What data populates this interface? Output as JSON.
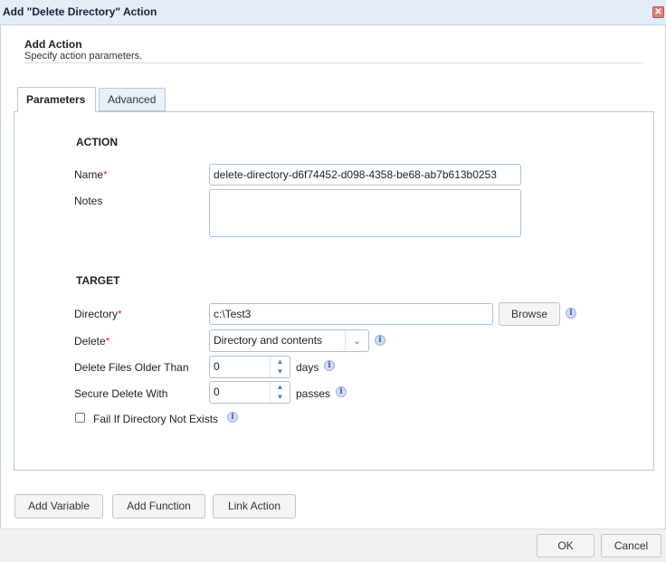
{
  "window": {
    "title": "Add \"Delete Directory\" Action",
    "close_glyph": "✕"
  },
  "header": {
    "title": "Add Action",
    "subtitle": "Specify action parameters."
  },
  "tabs": [
    {
      "label": "Parameters",
      "active": true
    },
    {
      "label": "Advanced",
      "active": false
    }
  ],
  "action_section": {
    "legend": "ACTION",
    "name_label": "Name",
    "name_value": "delete-directory-d6f74452-d098-4358-be68-ab7b613b0253",
    "notes_label": "Notes",
    "notes_value": ""
  },
  "target_section": {
    "legend": "TARGET",
    "directory_label": "Directory",
    "directory_value": "c:\\Test3",
    "browse_label": "Browse",
    "delete_label": "Delete",
    "delete_value": "Directory and contents",
    "older_than_label": "Delete Files Older Than",
    "older_than_value": "0",
    "older_than_unit": "days",
    "secure_label": "Secure Delete With",
    "secure_value": "0",
    "secure_unit": "passes",
    "fail_label": "Fail If Directory Not Exists",
    "fail_checked": false
  },
  "required_mark": "*",
  "info_glyph": "i",
  "buttons": {
    "add_variable": "Add Variable",
    "add_function": "Add Function",
    "link_action": "Link Action",
    "ok": "OK",
    "cancel": "Cancel"
  },
  "colors": {
    "accent_border": "#a9c2dc",
    "required": "#c0392b",
    "titlebar": "#e3ecf7"
  }
}
